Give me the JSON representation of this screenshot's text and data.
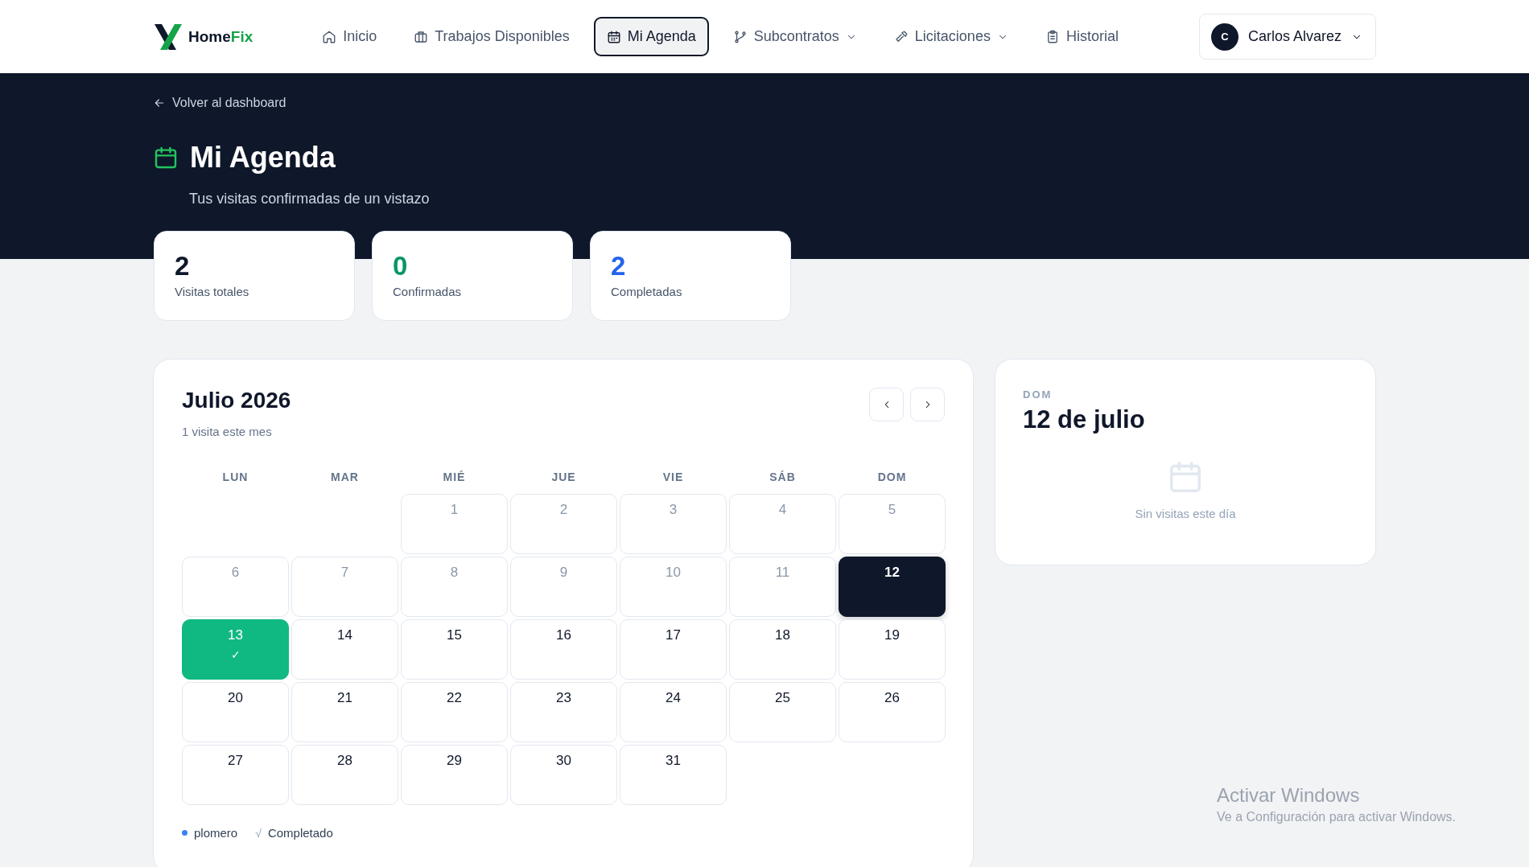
{
  "header": {
    "brand": {
      "name": "Home",
      "accent": "Fix"
    },
    "nav": [
      {
        "label": "Inicio",
        "selected": false,
        "has_menu": false
      },
      {
        "label": "Trabajos Disponibles",
        "selected": false,
        "has_menu": false
      },
      {
        "label": "Mi Agenda",
        "selected": true,
        "has_menu": false
      },
      {
        "label": "Subcontratos",
        "selected": false,
        "has_menu": true
      },
      {
        "label": "Licitaciones",
        "selected": false,
        "has_menu": true
      },
      {
        "label": "Historial",
        "selected": false,
        "has_menu": false
      }
    ],
    "user": {
      "initial": "C",
      "name": "Carlos Alvarez"
    }
  },
  "hero": {
    "back_link": "Volver al dashboard",
    "title": "Mi Agenda",
    "subtitle": "Tus visitas confirmadas de un vistazo"
  },
  "stats": [
    {
      "value": "2",
      "label": "Visitas totales",
      "color": "#0f172a"
    },
    {
      "value": "0",
      "label": "Confirmadas",
      "color": "#059669"
    },
    {
      "value": "2",
      "label": "Completadas",
      "color": "#2563eb"
    }
  ],
  "calendar": {
    "title": "Julio 2026",
    "subtitle": "1 visita este mes",
    "weekdays": [
      "LUN",
      "MAR",
      "MIÉ",
      "JUE",
      "VIE",
      "SÁB",
      "DOM"
    ],
    "days": [
      {
        "kind": "blank"
      },
      {
        "kind": "blank"
      },
      {
        "kind": "day",
        "day": "1",
        "disabled": true,
        "selected": false,
        "completed": false
      },
      {
        "kind": "day",
        "day": "2",
        "disabled": true,
        "selected": false,
        "completed": false
      },
      {
        "kind": "day",
        "day": "3",
        "disabled": true,
        "selected": false,
        "completed": false
      },
      {
        "kind": "day",
        "day": "4",
        "disabled": true,
        "selected": false,
        "completed": false
      },
      {
        "kind": "day",
        "day": "5",
        "disabled": true,
        "selected": false,
        "completed": false
      },
      {
        "kind": "day",
        "day": "6",
        "disabled": true,
        "selected": false,
        "completed": false
      },
      {
        "kind": "day",
        "day": "7",
        "disabled": true,
        "selected": false,
        "completed": false
      },
      {
        "kind": "day",
        "day": "8",
        "disabled": true,
        "selected": false,
        "completed": false
      },
      {
        "kind": "day",
        "day": "9",
        "disabled": true,
        "selected": false,
        "completed": false
      },
      {
        "kind": "day",
        "day": "10",
        "disabled": true,
        "selected": false,
        "completed": false
      },
      {
        "kind": "day",
        "day": "11",
        "disabled": true,
        "selected": false,
        "completed": false
      },
      {
        "kind": "day",
        "day": "12",
        "disabled": false,
        "selected": true,
        "completed": false
      },
      {
        "kind": "day",
        "day": "13",
        "disabled": false,
        "selected": false,
        "completed": true,
        "mark": "✓"
      },
      {
        "kind": "day",
        "day": "14",
        "disabled": false,
        "selected": false,
        "completed": false
      },
      {
        "kind": "day",
        "day": "15",
        "disabled": false,
        "selected": false,
        "completed": false
      },
      {
        "kind": "day",
        "day": "16",
        "disabled": false,
        "selected": false,
        "completed": false
      },
      {
        "kind": "day",
        "day": "17",
        "disabled": false,
        "selected": false,
        "completed": false
      },
      {
        "kind": "day",
        "day": "18",
        "disabled": false,
        "selected": false,
        "completed": false
      },
      {
        "kind": "day",
        "day": "19",
        "disabled": false,
        "selected": false,
        "completed": false
      },
      {
        "kind": "day",
        "day": "20",
        "disabled": false,
        "selected": false,
        "completed": false
      },
      {
        "kind": "day",
        "day": "21",
        "disabled": false,
        "selected": false,
        "completed": false
      },
      {
        "kind": "day",
        "day": "22",
        "disabled": false,
        "selected": false,
        "completed": false
      },
      {
        "kind": "day",
        "day": "23",
        "disabled": false,
        "selected": false,
        "completed": false
      },
      {
        "kind": "day",
        "day": "24",
        "disabled": false,
        "selected": false,
        "completed": false
      },
      {
        "kind": "day",
        "day": "25",
        "disabled": false,
        "selected": false,
        "completed": false
      },
      {
        "kind": "day",
        "day": "26",
        "disabled": false,
        "selected": false,
        "completed": false
      },
      {
        "kind": "day",
        "day": "27",
        "disabled": false,
        "selected": false,
        "completed": false
      },
      {
        "kind": "day",
        "day": "28",
        "disabled": false,
        "selected": false,
        "completed": false
      },
      {
        "kind": "day",
        "day": "29",
        "disabled": false,
        "selected": false,
        "completed": false
      },
      {
        "kind": "day",
        "day": "30",
        "disabled": false,
        "selected": false,
        "completed": false
      },
      {
        "kind": "day",
        "day": "31",
        "disabled": false,
        "selected": false,
        "completed": false
      }
    ],
    "legend": [
      {
        "kind": "dot",
        "label": "plomero",
        "color": "#3b82f6"
      },
      {
        "kind": "check",
        "symbol": "√",
        "label": "Completado"
      }
    ]
  },
  "day_panel": {
    "weekday": "DOM",
    "date": "12 de julio",
    "empty_text": "Sin visitas este día"
  },
  "os_overlay": {
    "title": "Activar Windows",
    "text": "Ve a Configuración para activar Windows."
  }
}
